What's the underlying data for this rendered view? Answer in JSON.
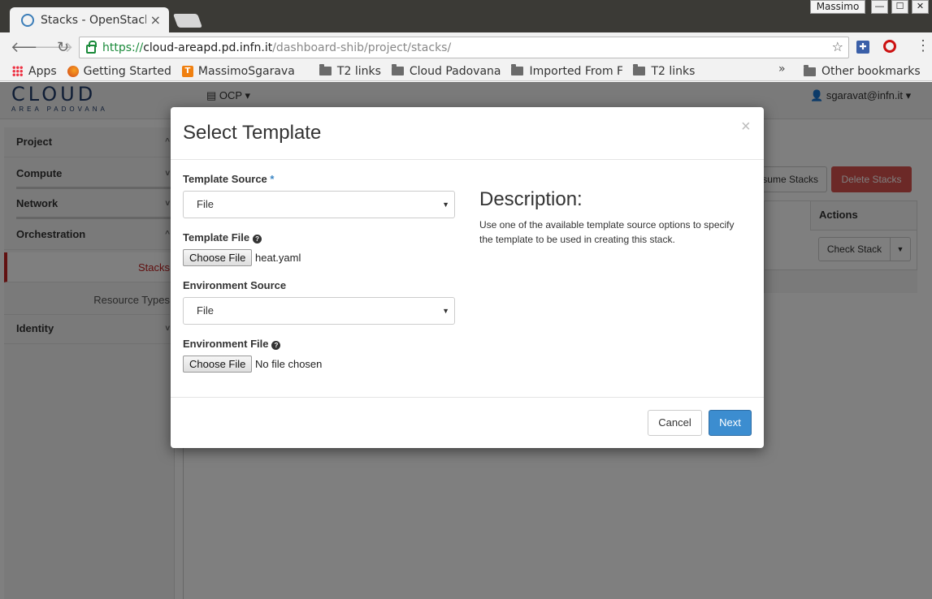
{
  "browser": {
    "tab_title": "Stacks - OpenStack",
    "tab_close": "×",
    "user": "Massimo",
    "win_minimize": "—",
    "win_maximize": "☐",
    "win_close": "✕",
    "url_scheme": "https://",
    "url_host": "cloud-areapd.pd.infn.it",
    "url_path": "/dashboard-shib/project/stacks/",
    "extension_label": "✚",
    "bookmarks": [
      {
        "label": "Apps",
        "icon": "apps-grid-icon"
      },
      {
        "label": "Getting Started",
        "icon": "firefox-icon"
      },
      {
        "label": "MassimoSgarava",
        "icon": "tweakers-icon"
      },
      {
        "label": "T2 links",
        "icon": "folder-icon"
      },
      {
        "label": "Cloud Padovana",
        "icon": "folder-icon"
      },
      {
        "label": "Imported From Fi",
        "icon": "folder-icon"
      },
      {
        "label": "T2 links",
        "icon": "folder-icon"
      }
    ],
    "bookmarks_more": "»",
    "other_bookmarks": "Other bookmarks"
  },
  "app": {
    "logo_main": "CLOUD",
    "logo_sub": "AREA PADOVANA",
    "project_menu": "OCP",
    "user_menu": "sgaravat@infn.it",
    "sidebar": {
      "project": "Project",
      "compute": "Compute",
      "network": "Network",
      "orchestration": "Orchestration",
      "stacks": "Stacks",
      "resource_types": "Resource Types",
      "identity": "Identity"
    },
    "resume_button": "sume Stacks",
    "delete_button": "Delete Stacks",
    "actions_header": "Actions",
    "check_stack_button": "Check Stack"
  },
  "modal": {
    "title": "Select Template",
    "close": "×",
    "template_source_label": "Template Source",
    "required_mark": "*",
    "template_source_value": "File",
    "template_file_label": "Template File",
    "template_file_button": "Choose File",
    "template_file_name": "heat.yaml",
    "environment_source_label": "Environment Source",
    "environment_source_value": "File",
    "environment_file_label": "Environment File",
    "environment_file_button": "Choose File",
    "environment_file_name": "No file chosen",
    "description_heading": "Description:",
    "description_text": "Use one of the available template source options to specify the template to be used in creating this stack.",
    "cancel": "Cancel",
    "next": "Next"
  }
}
